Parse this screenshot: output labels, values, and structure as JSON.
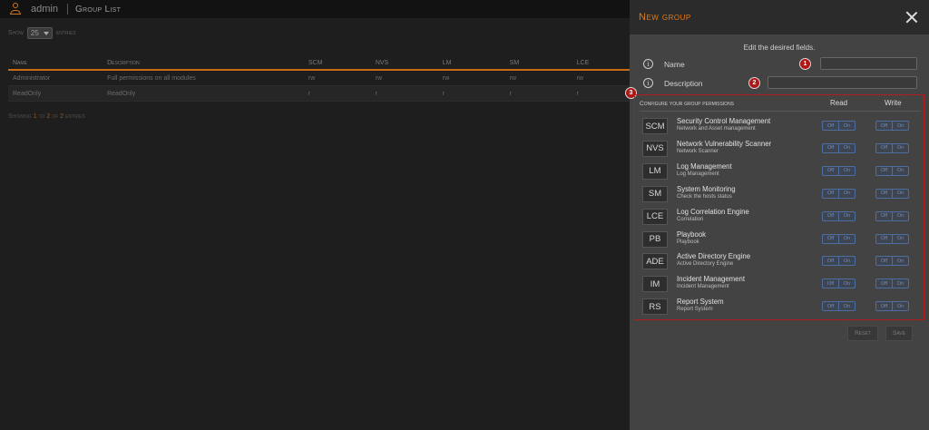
{
  "topbar": {
    "username": "admin",
    "breadcrumb": "Group List"
  },
  "list": {
    "show_label": "Show",
    "entries_value": "25",
    "entries_label": "entries",
    "columns": [
      "Name",
      "Description",
      "SCM",
      "NVS",
      "LM",
      "SM",
      "LCE"
    ],
    "rows": [
      {
        "name": "Administrator",
        "description": "Full permissions on all modules",
        "scm": "rw",
        "nvs": "rw",
        "lm": "rw",
        "sm": "rw",
        "lce": "rw"
      },
      {
        "name": "ReadOnly",
        "description": "ReadOnly",
        "scm": "r",
        "nvs": "r",
        "lm": "r",
        "sm": "r",
        "lce": "r"
      }
    ],
    "showing": {
      "prefix": "Showing",
      "from": "1",
      "to_label": "to",
      "to": "2",
      "of_label": "of",
      "total": "2",
      "suffix": "entries"
    }
  },
  "panel": {
    "title": "New group",
    "instructions": "Edit the desired fields.",
    "name_label": "Name",
    "name_value": "",
    "description_label": "Description",
    "description_value": "",
    "markers": [
      "1",
      "2",
      "3"
    ],
    "permissions_header": "Configure your group permissions",
    "read_label": "Read",
    "write_label": "Write",
    "off_label": "Off",
    "on_label": "On",
    "modules": [
      {
        "code": "SCM",
        "title": "Security Control Management",
        "subtitle": "Network and Asset management"
      },
      {
        "code": "NVS",
        "title": "Network Vulnerability Scanner",
        "subtitle": "Network Scanner"
      },
      {
        "code": "LM",
        "title": "Log Management",
        "subtitle": "Log Management"
      },
      {
        "code": "SM",
        "title": "System Monitoring",
        "subtitle": "Check the hosts status"
      },
      {
        "code": "LCE",
        "title": "Log Correlation Engine",
        "subtitle": "Correlation"
      },
      {
        "code": "PB",
        "title": "Playbook",
        "subtitle": "Playbook"
      },
      {
        "code": "ADE",
        "title": "Active Directory Engine",
        "subtitle": "Active Directory Engine"
      },
      {
        "code": "IM",
        "title": "Incident Management",
        "subtitle": "Incident Management"
      },
      {
        "code": "RS",
        "title": "Report System",
        "subtitle": "Report System"
      }
    ],
    "reset_label": "Reset",
    "save_label": "Save"
  },
  "colors": {
    "accent": "#e07b1a",
    "marker": "#b01818",
    "toggle": "#4c6ea0"
  }
}
